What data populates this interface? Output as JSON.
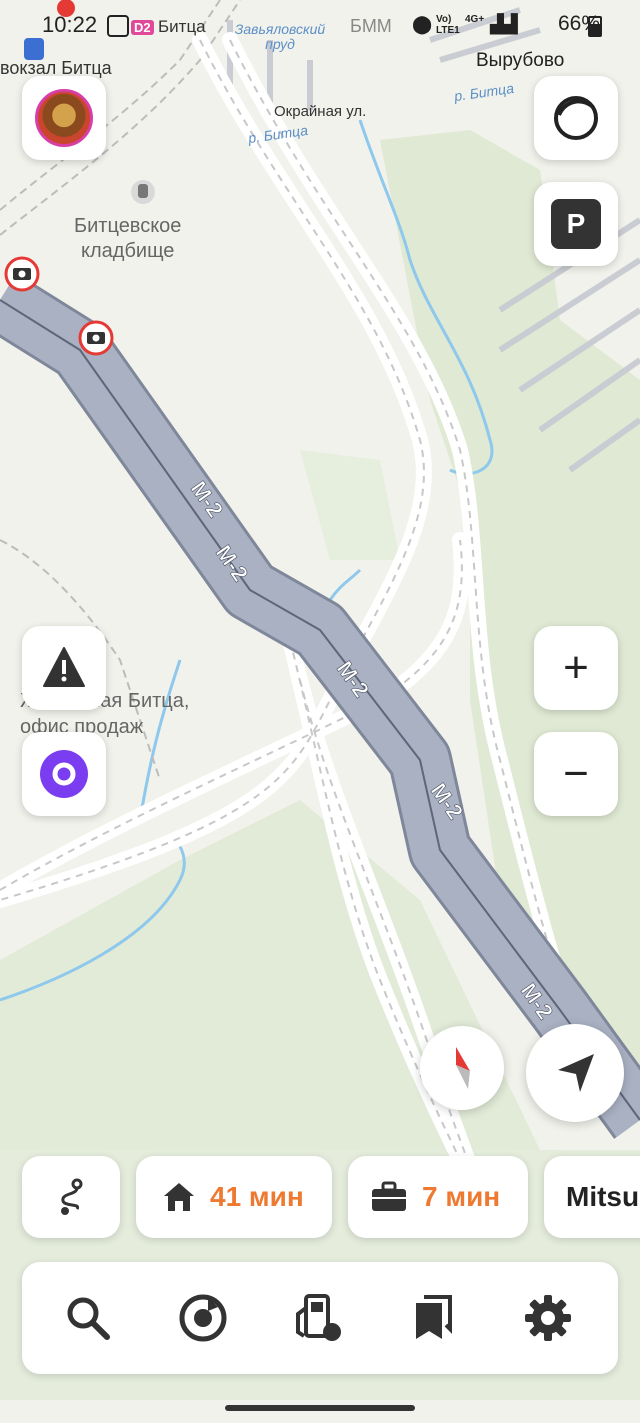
{
  "status_bar": {
    "time": "10:22",
    "badge": "D2",
    "station": "Битца",
    "network_lte": "Vo) LTE1",
    "network_4g": "4G+",
    "battery": "66%"
  },
  "map": {
    "labels": {
      "vokzal": "вокзал Битца",
      "zavyalovsky_pond": "Завьяловский пруд",
      "bmm": "БММ",
      "vyrubovo": "Вырубово",
      "okrainaya": "Окрайная ул.",
      "river_bitsa_1": "р. Битца",
      "river_bitsa_2": "р. Битца",
      "cemetery_line1": "Битцевское",
      "cemetery_line2": "кладбище",
      "office_line1": "ЖК Южная Битца,",
      "office_line2": "офис продаж"
    },
    "road_shields": [
      "М-2",
      "М-2",
      "М-2",
      "М-2",
      "М-2"
    ]
  },
  "controls": {
    "parking_label": "P",
    "zoom_in": "+",
    "zoom_out": "−"
  },
  "shortcuts": [
    {
      "name": "home",
      "label": "41 мин"
    },
    {
      "name": "work",
      "label": "7 мин"
    },
    {
      "name": "car",
      "label": "Mitsu"
    }
  ],
  "colors": {
    "accent_orange": "#ee7a32",
    "highway": "#a9b1c3",
    "alice_purple": "#7b3df0",
    "camera_red": "#e53935"
  }
}
